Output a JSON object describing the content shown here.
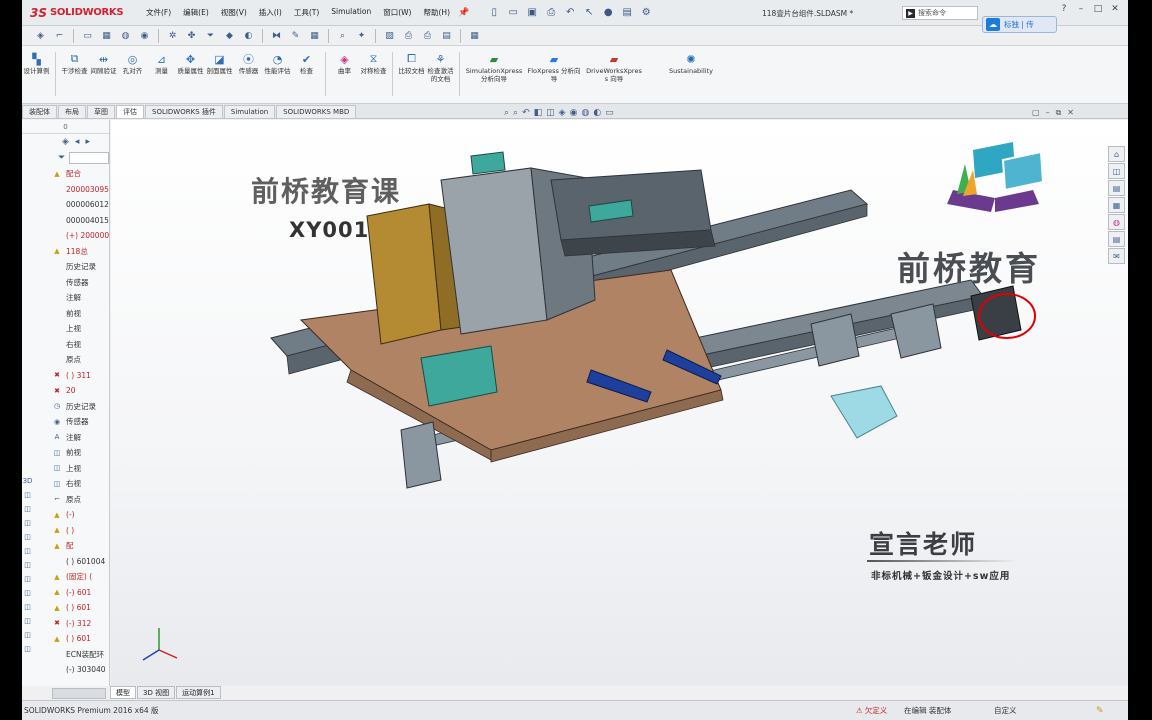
{
  "app": {
    "logo_mark": "3S",
    "logo_text": "SOLIDWORKS",
    "doc_title": "118壹片台组件.SLDASM *",
    "status_version": "SOLIDWORKS Premium 2016 x64 版"
  },
  "menu": [
    "文件(F)",
    "编辑(E)",
    "视图(V)",
    "插入(I)",
    "工具(T)",
    "Simulation",
    "窗口(W)",
    "帮助(H)"
  ],
  "search": {
    "placeholder": "搜索命令"
  },
  "overlay_pill": {
    "label": "标独 | 传"
  },
  "commands": [
    {
      "label": "设计算例",
      "icon": "study-icon"
    },
    {
      "label": "干涉检查",
      "icon": "interference-icon"
    },
    {
      "label": "间隙验证",
      "icon": "clearance-icon"
    },
    {
      "label": "孔对齐",
      "icon": "hole-align-icon"
    },
    {
      "label": "测量",
      "icon": "measure-icon"
    },
    {
      "label": "质量属性",
      "icon": "mass-icon"
    },
    {
      "label": "剖面属性",
      "icon": "section-icon"
    },
    {
      "label": "传感器",
      "icon": "sensor-icon"
    },
    {
      "label": "性能评估",
      "icon": "performance-icon"
    },
    {
      "label": "检查",
      "icon": "check-icon"
    },
    {
      "label": "曲率",
      "icon": "curvature-icon"
    },
    {
      "label": "对称检查",
      "icon": "symmetry-icon"
    },
    {
      "label": "比较文档",
      "icon": "compare-icon"
    },
    {
      "label": "检查激活的文档",
      "icon": "check-doc-icon"
    },
    {
      "label": "SimulationXpress 分析向导",
      "icon": "simxpress-icon"
    },
    {
      "label": "FloXpress 分析向导",
      "icon": "floxpress-icon"
    },
    {
      "label": "DriveWorksXpress 向导",
      "icon": "driveworks-icon"
    },
    {
      "label": "Sustainability",
      "icon": "sustainability-icon"
    }
  ],
  "tabs": [
    "装配体",
    "布局",
    "草图",
    "评估",
    "SOLIDWORKS 插件",
    "Simulation",
    "SOLIDWORKS MBD"
  ],
  "active_tab": "评估",
  "tree": {
    "header": "0",
    "rows": [
      {
        "icon": "warning-icon",
        "text": "配合",
        "color": "#c02525"
      },
      {
        "icon": "none",
        "text": "200003095",
        "color": "#c02525"
      },
      {
        "icon": "none",
        "text": "000006012",
        "color": "#333333"
      },
      {
        "icon": "none",
        "text": "000004015",
        "color": "#333333"
      },
      {
        "icon": "none",
        "text": "(+) 200000",
        "color": "#c02525"
      },
      {
        "icon": "warning-icon",
        "text": "118总",
        "color": "#c02525"
      },
      {
        "icon": "none",
        "text": "历史记录",
        "color": "#333333"
      },
      {
        "icon": "none",
        "text": "传感器",
        "color": "#333333"
      },
      {
        "icon": "none",
        "text": "注解",
        "color": "#333333"
      },
      {
        "icon": "none",
        "text": "前视",
        "color": "#333333"
      },
      {
        "icon": "none",
        "text": "上视",
        "color": "#333333"
      },
      {
        "icon": "none",
        "text": "右视",
        "color": "#333333"
      },
      {
        "icon": "none",
        "text": "原点",
        "color": "#333333"
      },
      {
        "icon": "error-icon",
        "text": "( ) 311",
        "color": "#c02525"
      },
      {
        "icon": "error-icon",
        "text": "20",
        "color": "#c02525"
      },
      {
        "icon": "history-icon",
        "text": "历史记录",
        "color": "#333333"
      },
      {
        "icon": "sensor-icon",
        "text": "传感器",
        "color": "#333333"
      },
      {
        "icon": "annotation-icon",
        "text": "注解",
        "color": "#333333"
      },
      {
        "icon": "plane-icon",
        "text": "前视",
        "color": "#333333"
      },
      {
        "icon": "plane-icon",
        "text": "上视",
        "color": "#333333"
      },
      {
        "icon": "plane-icon",
        "text": "右视",
        "color": "#333333"
      },
      {
        "icon": "origin-icon",
        "text": "原点",
        "color": "#333333"
      },
      {
        "icon": "warning-icon",
        "text": "(-)",
        "color": "#c02525"
      },
      {
        "icon": "warning-icon",
        "text": "( )",
        "color": "#c02525"
      },
      {
        "icon": "warning-icon",
        "text": "配",
        "color": "#c02525"
      },
      {
        "icon": "none",
        "text": "( ) 601004",
        "color": "#333333"
      },
      {
        "icon": "warning-icon",
        "text": "(固定) (",
        "color": "#c02525"
      },
      {
        "icon": "warning-icon",
        "text": "(-) 601",
        "color": "#c02525"
      },
      {
        "icon": "warning-icon",
        "text": "( ) 601",
        "color": "#c02525"
      },
      {
        "icon": "error-icon",
        "text": "(-) 312",
        "color": "#c02525"
      },
      {
        "icon": "warning-icon",
        "text": "( ) 601",
        "color": "#c02525"
      },
      {
        "icon": "none",
        "text": "ECN装配环",
        "color": "#333333"
      },
      {
        "icon": "none",
        "text": "(-) 303040",
        "color": "#333333"
      }
    ]
  },
  "bottom_tabs": [
    "模型",
    "3D 视图",
    "运动算例1"
  ],
  "status": {
    "warn": "欠定义",
    "editing": "在编辑 装配体",
    "custom": "自定义"
  },
  "watermark": {
    "title": "前桥教育课",
    "code": "XY001",
    "brand": "前桥教育",
    "teacher": "宣言老师",
    "sub": "非标机械+钣金设计+sw应用"
  },
  "colors": {
    "brand_red": "#d2202f",
    "warning_red": "#c02525",
    "accent_blue": "#1f6fd1",
    "model_plate": "#b08364",
    "model_steel": "#707c86",
    "model_teal": "#3fa89c",
    "model_bronze": "#b48a32",
    "model_blue_rod": "#1f3f9c"
  }
}
